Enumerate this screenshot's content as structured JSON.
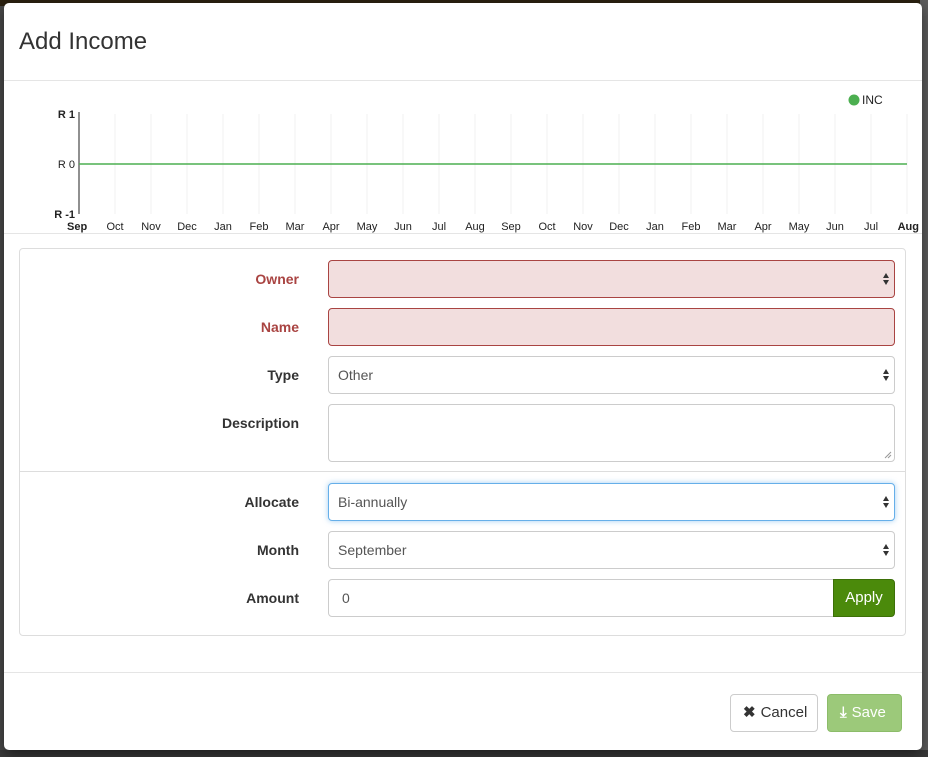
{
  "modal": {
    "title": "Add Income"
  },
  "chart_data": {
    "type": "line",
    "x": [
      "Sep",
      "Oct",
      "Nov",
      "Dec",
      "Jan",
      "Feb",
      "Mar",
      "Apr",
      "May",
      "Jun",
      "Jul",
      "Aug",
      "Sep",
      "Oct",
      "Nov",
      "Dec",
      "Jan",
      "Feb",
      "Mar",
      "Apr",
      "May",
      "Jun",
      "Jul",
      "Aug"
    ],
    "series": [
      {
        "name": "INC",
        "color": "#4caf50",
        "values": [
          0,
          0,
          0,
          0,
          0,
          0,
          0,
          0,
          0,
          0,
          0,
          0,
          0,
          0,
          0,
          0,
          0,
          0,
          0,
          0,
          0,
          0,
          0,
          0
        ]
      }
    ],
    "y_ticks": [
      "R 1",
      "R 0",
      "R -1"
    ],
    "ylim": [
      -1,
      1
    ],
    "grid": true,
    "legend_position": "top-right"
  },
  "form": {
    "owner": {
      "label": "Owner",
      "value": ""
    },
    "name": {
      "label": "Name",
      "value": ""
    },
    "type": {
      "label": "Type",
      "value": "Other"
    },
    "description": {
      "label": "Description",
      "value": ""
    },
    "allocate": {
      "label": "Allocate",
      "value": "Bi-annually"
    },
    "month": {
      "label": "Month",
      "value": "September"
    },
    "amount": {
      "label": "Amount",
      "value": "0",
      "apply_label": "Apply"
    }
  },
  "footer": {
    "cancel_label": "Cancel",
    "save_label": "Save"
  },
  "colors": {
    "error_text": "#a94442",
    "error_bg": "#f2dede",
    "apply_bg": "#4b8a0b",
    "save_bg": "#9cc97a",
    "series": "#4caf50"
  }
}
